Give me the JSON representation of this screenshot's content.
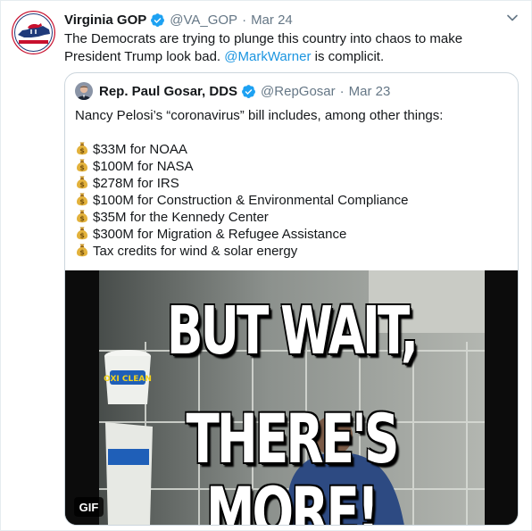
{
  "tweet": {
    "author_name": "Virginia GOP",
    "handle": "@VA_GOP",
    "separator": "·",
    "date": "Mar 24",
    "text_before": "The Democrats are trying to plunge this country into chaos to make President Trump look bad. ",
    "mention": "@MarkWarner",
    "text_after": " is complicit.",
    "avatar_icon": "virginia-gop-seal-icon",
    "avatar_seal_text_top": "REPUBLICAN PARTY",
    "avatar_seal_text_bottom": "VIRGINIA"
  },
  "quoted_tweet": {
    "author_name": "Rep. Paul Gosar, DDS",
    "handle": "@RepGosar",
    "separator": "·",
    "date": "Mar 23",
    "intro": "Nancy Pelosi’s “coronavirus” bill includes, among other things:",
    "items": [
      "$33M for NOAA",
      "$100M for NASA",
      "$278M for IRS",
      "$100M for Construction & Environmental Compliance",
      "$35M for the Kennedy Center",
      "$300M for Migration & Refugee Assistance",
      "Tax credits for wind & solar energy"
    ],
    "item_icon": "money-bag-icon",
    "media": {
      "caption_line1": "BUT WAIT,",
      "caption_line2": "THERE'S MORE!",
      "badge": "GIF",
      "product_label": "OXI CLEAN"
    }
  },
  "colors": {
    "text": "#14171a",
    "secondary": "#657786",
    "link": "#1b95e0",
    "verified": "#1da1f2",
    "border": "#ccd6dd"
  }
}
